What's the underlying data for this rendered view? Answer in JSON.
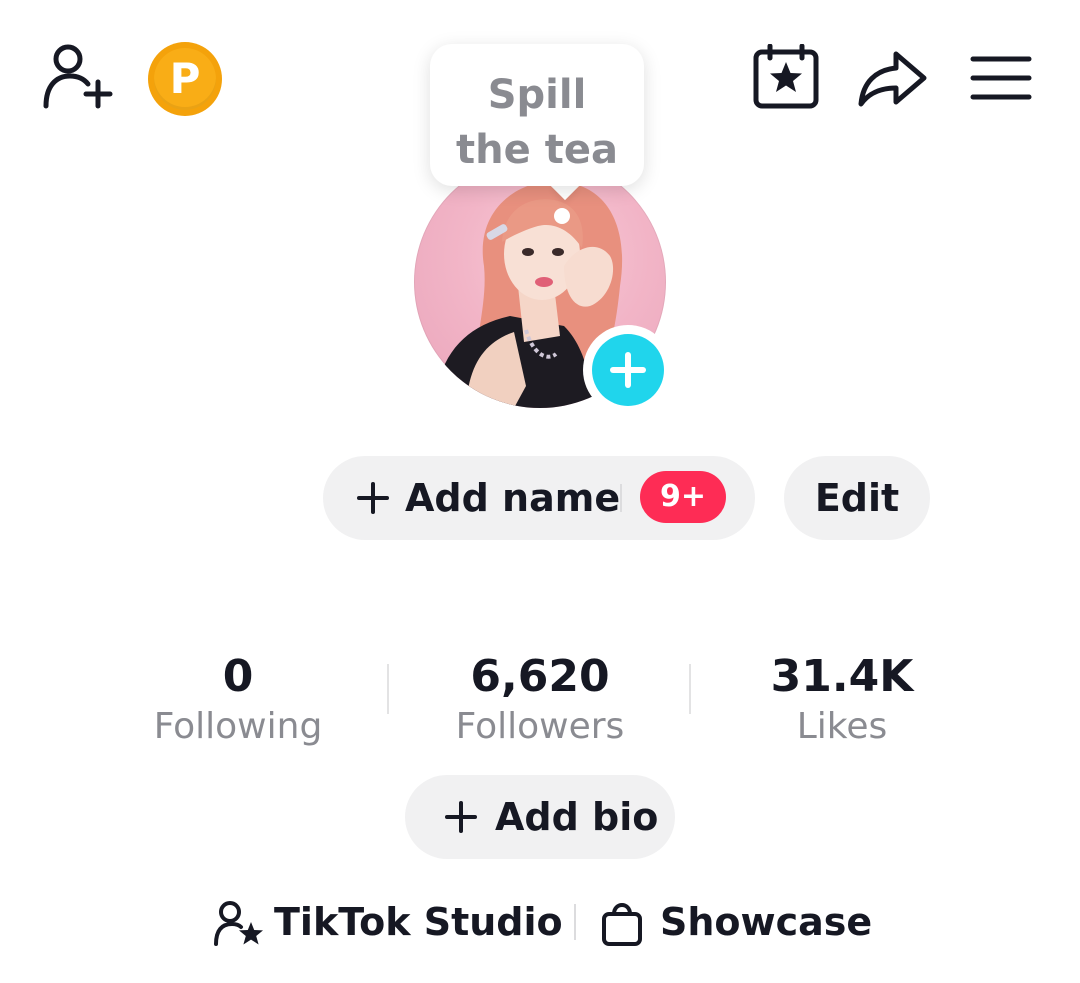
{
  "header": {
    "add_friend_icon": "person-add-icon",
    "coin_icon": "coin-icon",
    "coin_letter": "P",
    "calendar_icon": "calendar-star-icon",
    "share_icon": "share-arrow-icon",
    "menu_icon": "hamburger-menu-icon"
  },
  "tooltip": {
    "text": "Spill the tea"
  },
  "avatar": {
    "add_icon": "plus-icon",
    "add_color": "#20d5ec"
  },
  "profile_actions": {
    "add_name_label": "Add name",
    "add_name_icon": "plus-icon",
    "badge_count": "9+",
    "badge_color": "#fe2c55",
    "edit_label": "Edit"
  },
  "stats": [
    {
      "value": "0",
      "label": "Following"
    },
    {
      "value": "6,620",
      "label": "Followers"
    },
    {
      "value": "31.4K",
      "label": "Likes"
    }
  ],
  "bio": {
    "add_bio_label": "Add bio",
    "add_bio_icon": "plus-icon"
  },
  "links": {
    "studio_label": "TikTok Studio",
    "studio_icon": "person-star-icon",
    "showcase_label": "Showcase",
    "showcase_icon": "shopping-bag-icon"
  }
}
